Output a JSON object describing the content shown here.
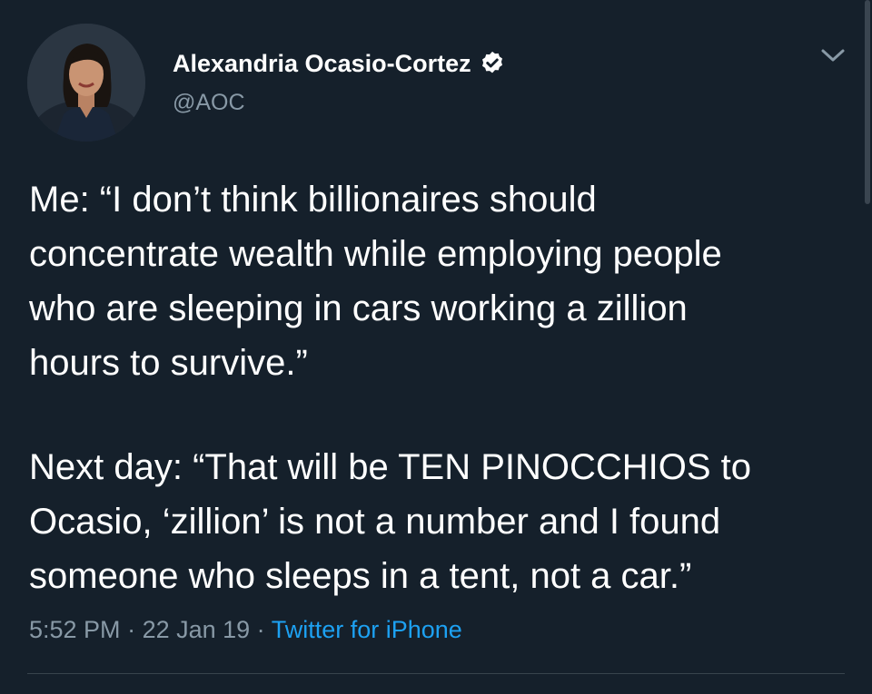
{
  "author": {
    "display_name": "Alexandria Ocasio-Cortez",
    "handle": "@AOC",
    "verified_icon": "verified-badge-icon",
    "avatar_icon": "profile-photo"
  },
  "tweet": {
    "paragraph_1": "Me: “I don’t think billionaires should\nconcentrate wealth while employing people\nwho are sleeping in cars working a zillion\nhours to survive.”",
    "paragraph_2": "Next day: “That will be TEN PINOCCHIOS to\nOcasio, ‘zillion’ is not a number and I found\nsomeone who sleeps in a tent, not a car.”"
  },
  "meta": {
    "time": "5:52 PM",
    "separator": " · ",
    "date": "22 Jan 19",
    "source": "Twitter for iPhone"
  },
  "controls": {
    "menu_icon": "chevron-down-icon"
  },
  "colors": {
    "background": "#15202b",
    "secondary_text": "#8899a6",
    "link": "#1da1f2"
  }
}
